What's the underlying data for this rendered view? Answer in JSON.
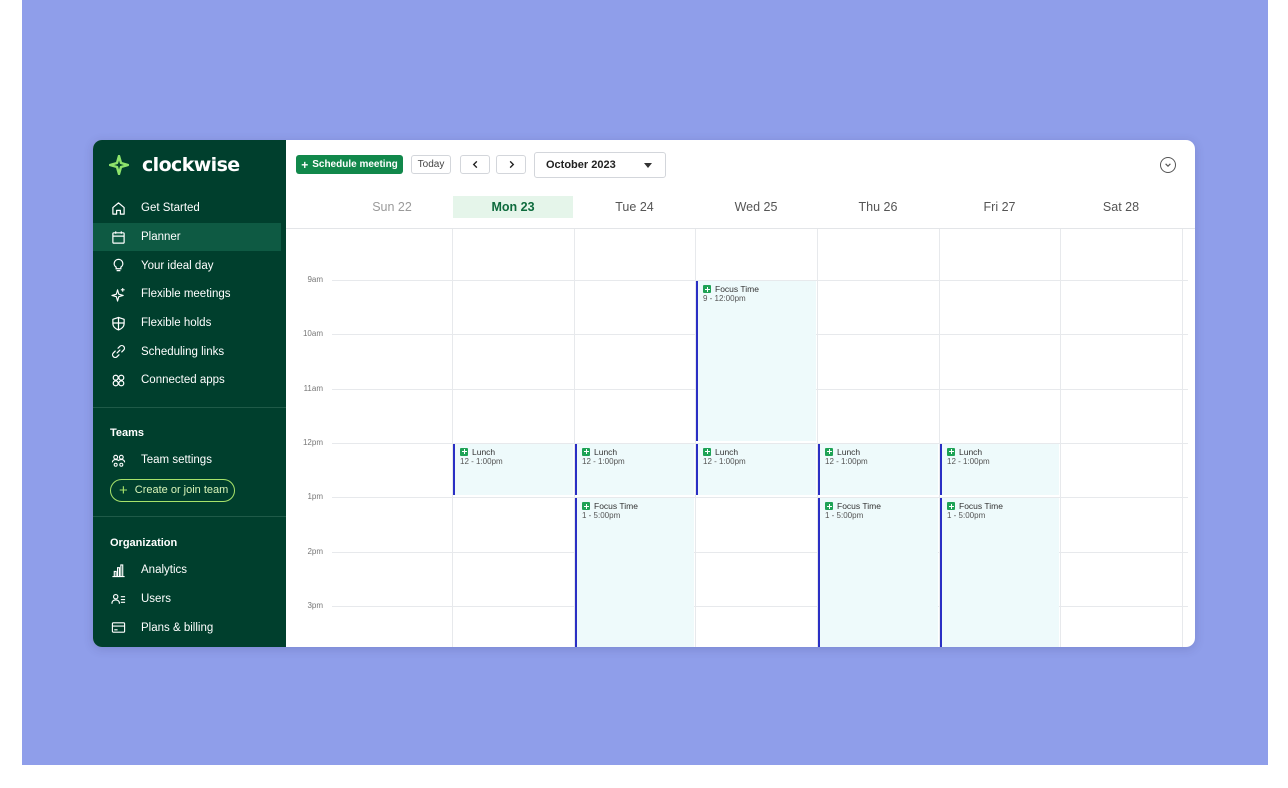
{
  "app": {
    "name": "clockwise"
  },
  "sidebar": {
    "items": [
      {
        "label": "Get Started",
        "icon": "home-icon"
      },
      {
        "label": "Planner",
        "icon": "calendar-icon",
        "active": true
      },
      {
        "label": "Your ideal day",
        "icon": "lightbulb-icon"
      },
      {
        "label": "Flexible meetings",
        "icon": "sparkle-icon"
      },
      {
        "label": "Flexible holds",
        "icon": "shield-icon"
      },
      {
        "label": "Scheduling links",
        "icon": "link-icon"
      },
      {
        "label": "Connected apps",
        "icon": "apps-icon"
      }
    ],
    "teams": {
      "title": "Teams",
      "settings_label": "Team settings",
      "create_label": "Create or join team"
    },
    "organization": {
      "title": "Organization",
      "items": [
        {
          "label": "Analytics",
          "icon": "bar-chart-icon"
        },
        {
          "label": "Users",
          "icon": "users-list-icon"
        },
        {
          "label": "Plans & billing",
          "icon": "credit-card-icon"
        }
      ]
    }
  },
  "toolbar": {
    "schedule_label": "Schedule meeting",
    "today_label": "Today",
    "month": "October 2023"
  },
  "calendar": {
    "days": [
      {
        "label": "Sun 22",
        "muted": true
      },
      {
        "label": "Mon 23",
        "today": true
      },
      {
        "label": "Tue 24"
      },
      {
        "label": "Wed 25"
      },
      {
        "label": "Thu 26"
      },
      {
        "label": "Fri 27"
      },
      {
        "label": "Sat 28"
      }
    ],
    "hours": [
      "9am",
      "10am",
      "11am",
      "12pm",
      "1pm",
      "2pm",
      "3pm"
    ],
    "events": [
      {
        "day": 3,
        "start": 9,
        "end": 12,
        "title": "Focus Time",
        "time": "9 - 12:00pm"
      },
      {
        "day": 1,
        "start": 12,
        "end": 13,
        "title": "Lunch",
        "time": "12 - 1:00pm"
      },
      {
        "day": 2,
        "start": 12,
        "end": 13,
        "title": "Lunch",
        "time": "12 - 1:00pm"
      },
      {
        "day": 3,
        "start": 12,
        "end": 13,
        "title": "Lunch",
        "time": "12 - 1:00pm"
      },
      {
        "day": 4,
        "start": 12,
        "end": 13,
        "title": "Lunch",
        "time": "12 - 1:00pm"
      },
      {
        "day": 5,
        "start": 12,
        "end": 13,
        "title": "Lunch",
        "time": "12 - 1:00pm"
      },
      {
        "day": 2,
        "start": 13,
        "end": 17,
        "title": "Focus Time",
        "time": "1 - 5:00pm"
      },
      {
        "day": 4,
        "start": 13,
        "end": 17,
        "title": "Focus Time",
        "time": "1 - 5:00pm"
      },
      {
        "day": 5,
        "start": 13,
        "end": 17,
        "title": "Focus Time",
        "time": "1 - 5:00pm"
      }
    ]
  },
  "colors": {
    "sidebar_bg": "#003f2d",
    "primary_button": "#11884b",
    "event_border": "#2a2fc4",
    "event_bg": "#eefafb",
    "backdrop": "#8f9eea"
  }
}
